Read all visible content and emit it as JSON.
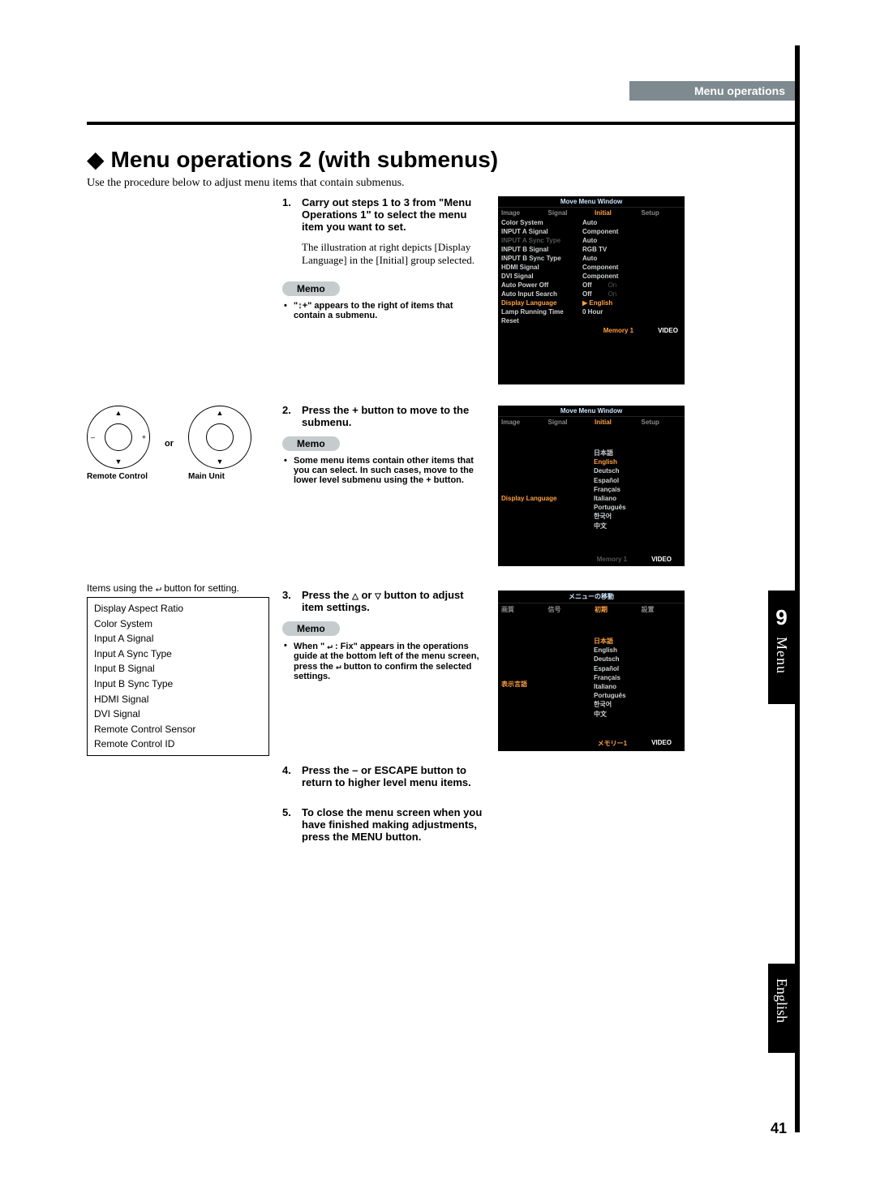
{
  "header": {
    "tab": "Menu operations"
  },
  "title": "Menu operations 2 (with submenus)",
  "intro": "Use the procedure below to adjust menu items that contain submenus.",
  "steps": {
    "s1": {
      "num": "1.",
      "text": "Carry out steps 1 to 3 from \"Menu Operations 1\" to select the menu item you want to set."
    },
    "s1_note": "The illustration at right depicts [Display Language] in the [Initial] group selected.",
    "memo_label": "Memo",
    "memo1": "\"↕+\" appears to the right of items that contain a submenu.",
    "s2": {
      "num": "2.",
      "text": "Press the + button to move to the submenu."
    },
    "memo2": "Some menu items contain other items that you can select. In such cases, move to the lower level submenu using the + button.",
    "s3": {
      "num": "3.",
      "text_pre": "Press the ",
      "text_mid": " or ",
      "text_post": " button to adjust item settings."
    },
    "memo3_pre": "When \" ",
    "memo3_icon": "↵",
    "memo3_mid": " : Fix\" appears in the operations guide at the bottom left of the menu screen, press the ",
    "memo3_post": " button to confirm the selected settings.",
    "s4": {
      "num": "4.",
      "text": "Press the – or ESCAPE button to return to higher level menu items."
    },
    "s5": {
      "num": "5.",
      "text": "To close the menu screen when you have finished making adjustments, press the MENU button."
    }
  },
  "controls": {
    "or": "or",
    "remote": "Remote Control",
    "main": "Main Unit",
    "minus": "–",
    "plus": "+"
  },
  "items_box": {
    "header_pre": "Items using the ",
    "header_icon": "↵",
    "header_post": " button for setting.",
    "list": [
      "Display Aspect Ratio",
      "Color System",
      "Input A Signal",
      "Input A Sync Type",
      "Input B Signal",
      "Input B Sync Type",
      "HDMI Signal",
      "DVI Signal",
      "Remote Control Sensor",
      "Remote Control ID"
    ]
  },
  "screenshots": {
    "s1": {
      "title": "Move Menu Window",
      "tabs": [
        "Image",
        "Signal",
        "Initial",
        "Setup"
      ],
      "active_tab": 2,
      "rows": [
        {
          "k": "Color System",
          "v": "Auto"
        },
        {
          "k": "INPUT A Signal",
          "v": "Component"
        },
        {
          "k": "INPUT A Sync Type",
          "v": "Auto",
          "dim": true
        },
        {
          "k": "INPUT B Signal",
          "v": "RGB TV"
        },
        {
          "k": "INPUT B Sync Type",
          "v": "Auto"
        },
        {
          "k": "HDMI Signal",
          "v": "Component"
        },
        {
          "k": "DVI Signal",
          "v": "Component"
        },
        {
          "k": "Auto Power Off",
          "v": "Off",
          "opt": "On"
        },
        {
          "k": "Auto Input Search",
          "v": "Off",
          "opt": "On"
        },
        {
          "k": "Display Language",
          "v": "English",
          "sel": true,
          "marker": "▶"
        },
        {
          "k": "Lamp Running Time",
          "v": "0 Hour"
        },
        {
          "k": "Reset",
          "v": ""
        }
      ],
      "foot": {
        "memory": "Memory 1",
        "video": "VIDEO"
      }
    },
    "s2": {
      "title": "Move Menu Window",
      "tabs": [
        "Image",
        "Signal",
        "Initial",
        "Setup"
      ],
      "active_tab": 2,
      "side_label": "Display Language",
      "langs": [
        "日本語",
        "English",
        "Deutsch",
        "Español",
        "Français",
        "Italiano",
        "Português",
        "한국어",
        "中文"
      ],
      "sel": 1,
      "foot": {
        "memory": "Memory 1",
        "video": "VIDEO"
      }
    },
    "s3": {
      "title": "メニューの移動",
      "tabs": [
        "画質",
        "信号",
        "初期",
        "設置"
      ],
      "active_tab": 2,
      "side_label": "表示言語",
      "langs": [
        "日本語",
        "English",
        "Deutsch",
        "Español",
        "Français",
        "Italiano",
        "Português",
        "한국어",
        "中文"
      ],
      "sel": 0,
      "foot": {
        "memory": "メモリー1",
        "video": "VIDEO"
      }
    }
  },
  "side": {
    "chapter_num": "9",
    "chapter": "Menu",
    "lang": "English"
  },
  "page_num": "41"
}
